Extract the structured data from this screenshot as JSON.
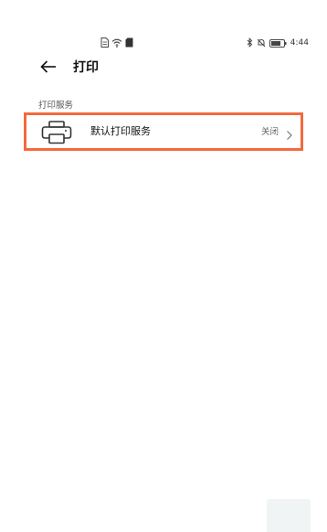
{
  "status_bar": {
    "time": "4:44",
    "left_icons": [
      "document-icon",
      "wifi-icon",
      "sim-icon"
    ],
    "right_icons": [
      "bluetooth-icon",
      "mute-icon",
      "battery-icon"
    ]
  },
  "header": {
    "title": "打印",
    "back_icon": "back-arrow-icon"
  },
  "section": {
    "label": "打印服务",
    "items": [
      {
        "icon": "printer-icon",
        "label": "默认打印服务",
        "status": "关闭",
        "chevron": "chevron-right-icon"
      }
    ]
  },
  "colors": {
    "highlight_border": "#f26a3d",
    "background": "#ffffff"
  }
}
